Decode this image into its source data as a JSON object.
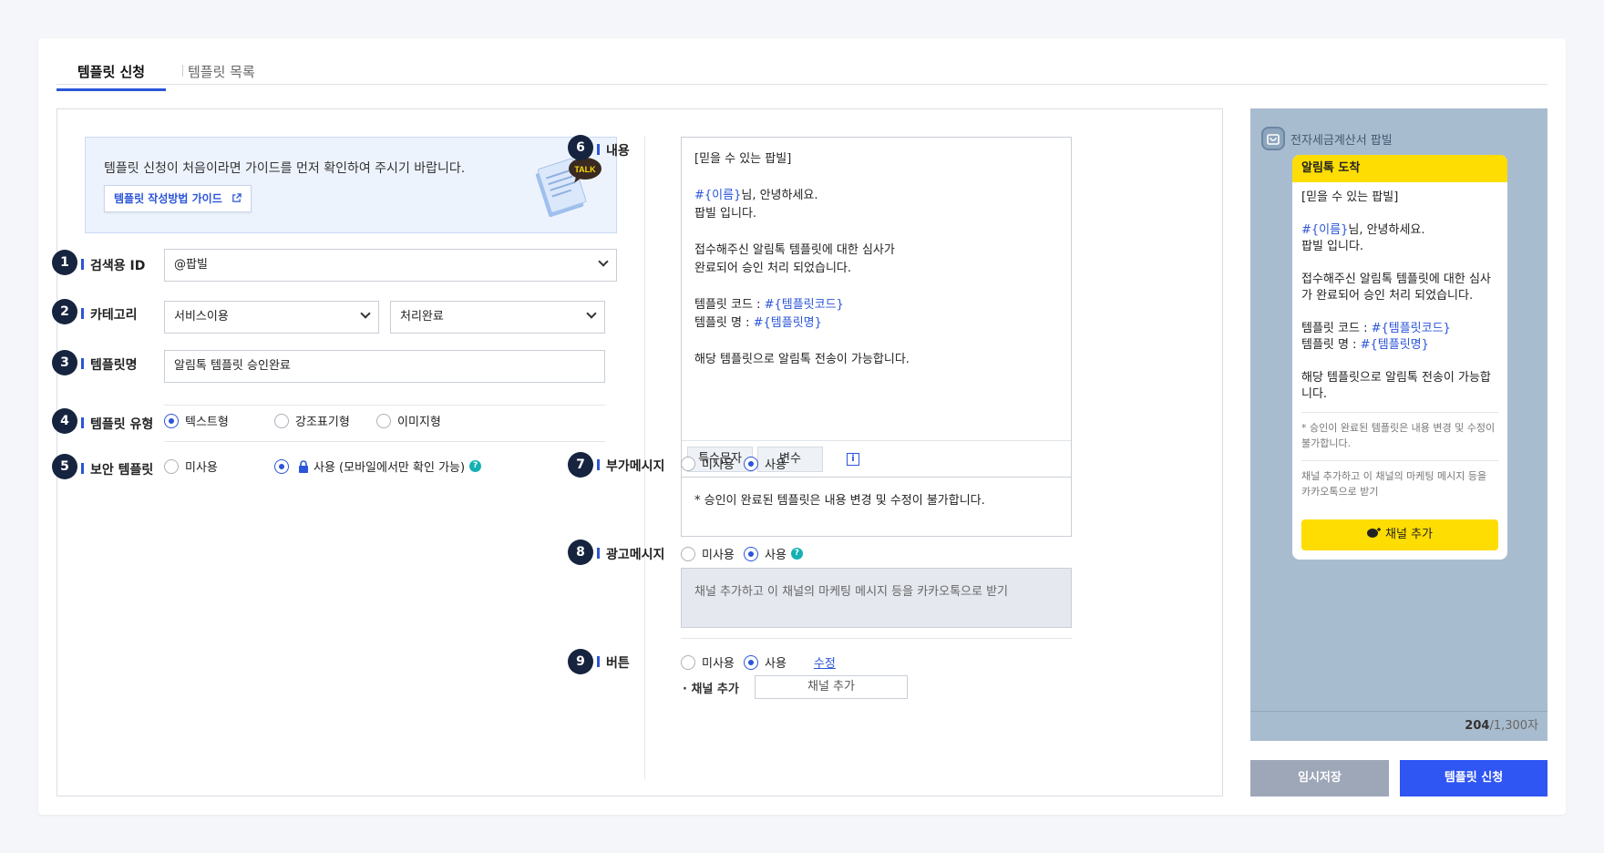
{
  "tabs": {
    "active": "템플릿 신청",
    "inactive": "템플릿 목록"
  },
  "guide": {
    "text": "템플릿 신청이 처음이라면 가이드를 먼저 확인하여 주시기 바랍니다.",
    "button": "템플릿 작성방법 가이드",
    "talk_badge": "TALK"
  },
  "numbers": [
    "1",
    "2",
    "3",
    "4",
    "5",
    "6",
    "7",
    "8",
    "9"
  ],
  "fields": {
    "search_id": {
      "label": "검색용 ID",
      "value": "@팝빌"
    },
    "category": {
      "label": "카테고리",
      "value1": "서비스이용",
      "value2": "처리완료"
    },
    "template_name": {
      "label": "템플릿명",
      "value": "알림톡 템플릿 승인완료"
    },
    "template_type": {
      "label": "템플릿 유형",
      "options": [
        "텍스트형",
        "강조표기형",
        "이미지형"
      ],
      "selected": "텍스트형"
    },
    "secure": {
      "label": "보안 템플릿",
      "options": [
        "미사용",
        "사용 (모바일에서만 확인 가능)"
      ],
      "selected": "사용 (모바일에서만 확인 가능)"
    }
  },
  "content": {
    "label": "내용",
    "line1": "[믿을 수 있는 팝빌]",
    "var_name": "#{이름}",
    "line2_suffix": "님, 안녕하세요.",
    "line3": "팝빌 입니다.",
    "line4": "접수해주신 알림톡 템플릿에 대한 심사가",
    "line5": "완료되어 승인 처리 되었습니다.",
    "code_label": "템플릿 코드 : ",
    "code_var": "#{템플릿코드}",
    "name_label": "템플릿 명 : ",
    "name_var": "#{템플릿명}",
    "line6": "해당 템플릿으로 알림톡 전송이 가능합니다.",
    "special_chars": "특수문자",
    "variable": "변수",
    "info": "i"
  },
  "extra_msg": {
    "label": "부가메시지",
    "options": [
      "미사용",
      "사용"
    ],
    "selected": "사용",
    "text": "* 승인이 완료된 템플릿은 내용 변경 및 수정이 불가합니다."
  },
  "ad_msg": {
    "label": "광고메시지",
    "options": [
      "미사용",
      "사용"
    ],
    "selected": "사용",
    "text": "채널 추가하고 이 채널의 마케팅 메시지 등을 카카오톡으로 받기"
  },
  "button_field": {
    "label": "버튼",
    "options": [
      "미사용",
      "사용"
    ],
    "selected": "사용",
    "edit": "수정",
    "channel_label": "채널 추가",
    "channel_value": "채널 추가"
  },
  "preview": {
    "sender": "전자세금계산서 팝빌",
    "header": "알림톡 도착",
    "line1": "[믿을 수 있는 팝빌]",
    "var_name": "#{이름}",
    "line2_suffix": "님, 안녕하세요.",
    "line3": "팝빌 입니다.",
    "line4": "접수해주신 알림톡 템플릿에 대한 심사가 완료되어 승인 처리 되었습니다.",
    "code_label": "템플릿 코드 : ",
    "code_var": "#{템플릿코드}",
    "name_label": "템플릿 명 : ",
    "name_var": "#{템플릿명}",
    "line6": "해당 템플릿으로 알림톡 전송이 가능합니다.",
    "note1": "* 승인이 완료된 템플릿은 내용 변경 및 수정이 불가합니다.",
    "note2": "채널 추가하고 이 채널의 마케팅 메시지 등을 카카오톡으로 받기",
    "button": "채널 추가",
    "count": "204",
    "max": "/1,300자"
  },
  "actions": {
    "save": "임시저장",
    "apply": "템플릿 신청"
  },
  "colors": {
    "accent": "#2b55d8",
    "kakao_yellow": "#fedd03",
    "navy": "#16243f",
    "preview_bg": "#a8bccf"
  }
}
